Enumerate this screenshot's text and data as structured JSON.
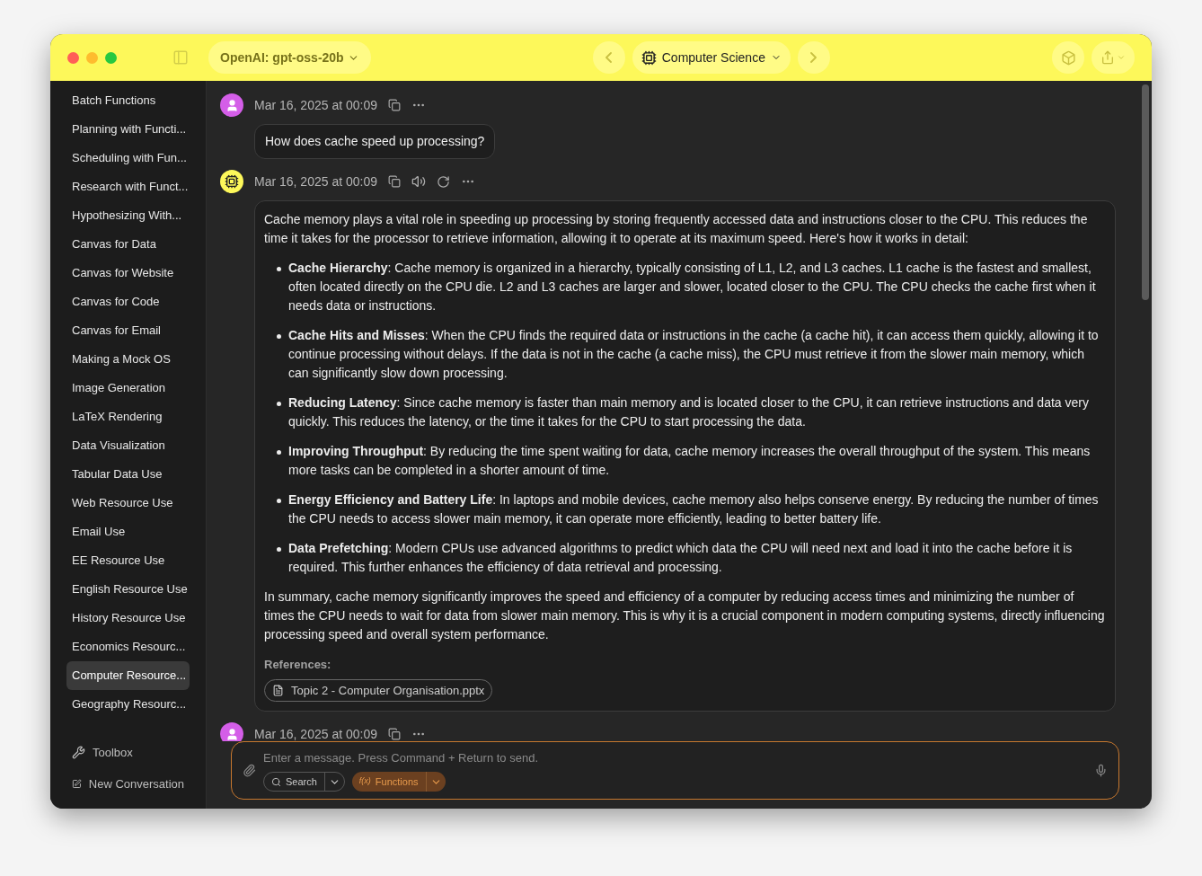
{
  "toolbar": {
    "model": "OpenAI: gpt-oss-20b",
    "topic": "Computer Science"
  },
  "sidebar": {
    "items": [
      {
        "label": "Batch Functions",
        "selected": false
      },
      {
        "label": "Planning with Functi...",
        "selected": false
      },
      {
        "label": "Scheduling with Fun...",
        "selected": false
      },
      {
        "label": "Research with Funct...",
        "selected": false
      },
      {
        "label": "Hypothesizing With...",
        "selected": false
      },
      {
        "label": "Canvas for Data",
        "selected": false
      },
      {
        "label": "Canvas for Website",
        "selected": false
      },
      {
        "label": "Canvas for Code",
        "selected": false
      },
      {
        "label": "Canvas for Email",
        "selected": false
      },
      {
        "label": "Making a Mock OS",
        "selected": false
      },
      {
        "label": "Image Generation",
        "selected": false
      },
      {
        "label": "LaTeX Rendering",
        "selected": false
      },
      {
        "label": "Data Visualization",
        "selected": false
      },
      {
        "label": "Tabular Data Use",
        "selected": false
      },
      {
        "label": "Web Resource Use",
        "selected": false
      },
      {
        "label": "Email Use",
        "selected": false
      },
      {
        "label": "EE Resource Use",
        "selected": false
      },
      {
        "label": "English Resource Use",
        "selected": false
      },
      {
        "label": "History Resource Use",
        "selected": false
      },
      {
        "label": "Economics Resourc...",
        "selected": false
      },
      {
        "label": "Computer Resource...",
        "selected": true
      },
      {
        "label": "Geography Resourc...",
        "selected": false
      }
    ],
    "footer": [
      {
        "kind": "toolbox",
        "label": "Toolbox"
      },
      {
        "kind": "new",
        "label": "New Conversation"
      }
    ]
  },
  "messages": [
    {
      "kind": "user",
      "time": "Mar 16, 2025 at 00:09",
      "text": "How does cache speed up processing?"
    },
    {
      "kind": "assistant",
      "time": "Mar 16, 2025 at 00:09",
      "intro": "Cache memory plays a vital role in speeding up processing by storing frequently accessed data and instructions closer to the CPU. This reduces the time it takes for the processor to retrieve information, allowing it to operate at its maximum speed. Here's how it works in detail:",
      "bullets": [
        "**Cache Hierarchy**: Cache memory is organized in a hierarchy, typically consisting of L1, L2, and L3 caches. L1 cache is the fastest and smallest, often located directly on the CPU die. L2 and L3 caches are larger and slower, located closer to the CPU. The CPU checks the cache first when it needs data or instructions.",
        "**Cache Hits and Misses**: When the CPU finds the required data or instructions in the cache (a cache hit), it can access them quickly, allowing it to continue processing without delays. If the data is not in the cache (a cache miss), the CPU must retrieve it from the slower main memory, which can significantly slow down processing.",
        "**Reducing Latency**: Since cache memory is faster than main memory and is located closer to the CPU, it can retrieve instructions and data very quickly. This reduces the latency, or the time it takes for the CPU to start processing the data.",
        "**Improving Throughput**: By reducing the time spent waiting for data, cache memory increases the overall throughput of the system. This means more tasks can be completed in a shorter amount of time.",
        "**Energy Efficiency and Battery Life**: In laptops and mobile devices, cache memory also helps conserve energy. By reducing the number of times the CPU needs to access slower main memory, it can operate more efficiently, leading to better battery life.",
        "**Data Prefetching**: Modern CPUs use advanced algorithms to predict which data the CPU will need next and load it into the cache before it is required. This further enhances the efficiency of data retrieval and processing."
      ],
      "summary": "In summary, cache memory significantly improves the speed and efficiency of a computer by reducing access times and minimizing the number of times the CPU needs to wait for data from slower main memory. This is why it is a crucial component in modern computing systems, directly influencing processing speed and overall system performance.",
      "references_label": "References:",
      "references": [
        "Topic 2 - Computer Organisation.pptx"
      ]
    },
    {
      "kind": "user",
      "time": "Mar 16, 2025 at 00:09"
    }
  ],
  "composer": {
    "placeholder": "Enter a message. Press Command + Return to send.",
    "tools": [
      {
        "kind": "search",
        "label": "Search",
        "on": false
      },
      {
        "kind": "function",
        "icon_text": "f(x)",
        "label": "Functions",
        "on": true
      }
    ]
  }
}
